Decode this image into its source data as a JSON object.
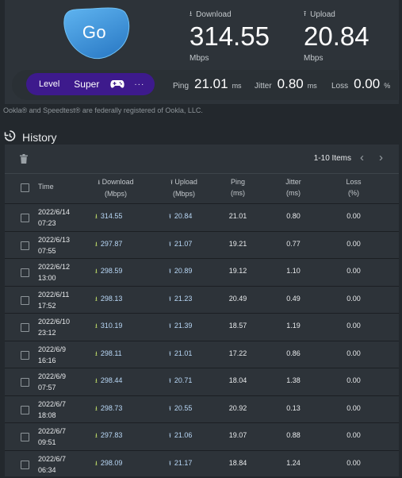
{
  "speedtest": {
    "go_label": "Go",
    "download": {
      "label": "Download",
      "value": "314.55",
      "unit": "Mbps"
    },
    "upload": {
      "label": "Upload",
      "value": "20.84",
      "unit": "Mbps"
    },
    "level": {
      "label": "Level",
      "value": "Super",
      "more": "···"
    },
    "ping": {
      "label": "Ping",
      "value": "21.01",
      "unit": "ms"
    },
    "jitter": {
      "label": "Jitter",
      "value": "0.80",
      "unit": "ms"
    },
    "loss": {
      "label": "Loss",
      "value": "0.00",
      "unit": "%"
    },
    "brand_color": "#3d1a8c",
    "go_color": "#4a9fe0"
  },
  "notice": "Ookla® and Speedtest® are federally registered of Ookla, LLC.",
  "history": {
    "title": "History",
    "pager": "1-10 Items",
    "columns": {
      "time": "Time",
      "download": "Download",
      "download_unit": "(Mbps)",
      "upload": "Upload",
      "upload_unit": "(Mbps)",
      "ping": "Ping",
      "ping_unit": "(ms)",
      "jitter": "Jitter",
      "jitter_unit": "(ms)",
      "loss": "Loss",
      "loss_unit": "(%)"
    },
    "rows": [
      {
        "date": "2022/6/14",
        "time": "07:23",
        "download": "314.55",
        "upload": "20.84",
        "ping": "21.01",
        "jitter": "0.80",
        "loss": "0.00"
      },
      {
        "date": "2022/6/13",
        "time": "07:55",
        "download": "297.87",
        "upload": "21.07",
        "ping": "19.21",
        "jitter": "0.77",
        "loss": "0.00"
      },
      {
        "date": "2022/6/12",
        "time": "13:00",
        "download": "298.59",
        "upload": "20.89",
        "ping": "19.12",
        "jitter": "1.10",
        "loss": "0.00"
      },
      {
        "date": "2022/6/11",
        "time": "17:52",
        "download": "298.13",
        "upload": "21.23",
        "ping": "20.49",
        "jitter": "0.49",
        "loss": "0.00"
      },
      {
        "date": "2022/6/10",
        "time": "23:12",
        "download": "310.19",
        "upload": "21.39",
        "ping": "18.57",
        "jitter": "1.19",
        "loss": "0.00"
      },
      {
        "date": "2022/6/9",
        "time": "16:16",
        "download": "298.11",
        "upload": "21.01",
        "ping": "17.22",
        "jitter": "0.86",
        "loss": "0.00"
      },
      {
        "date": "2022/6/9",
        "time": "07:57",
        "download": "298.44",
        "upload": "20.71",
        "ping": "18.04",
        "jitter": "1.38",
        "loss": "0.00"
      },
      {
        "date": "2022/6/7",
        "time": "18:08",
        "download": "298.73",
        "upload": "20.55",
        "ping": "20.92",
        "jitter": "0.13",
        "loss": "0.00"
      },
      {
        "date": "2022/6/7",
        "time": "09:51",
        "download": "297.83",
        "upload": "21.06",
        "ping": "19.07",
        "jitter": "0.88",
        "loss": "0.00"
      },
      {
        "date": "2022/6/7",
        "time": "06:34",
        "download": "298.09",
        "upload": "21.17",
        "ping": "18.84",
        "jitter": "1.24",
        "loss": "0.00"
      }
    ]
  }
}
